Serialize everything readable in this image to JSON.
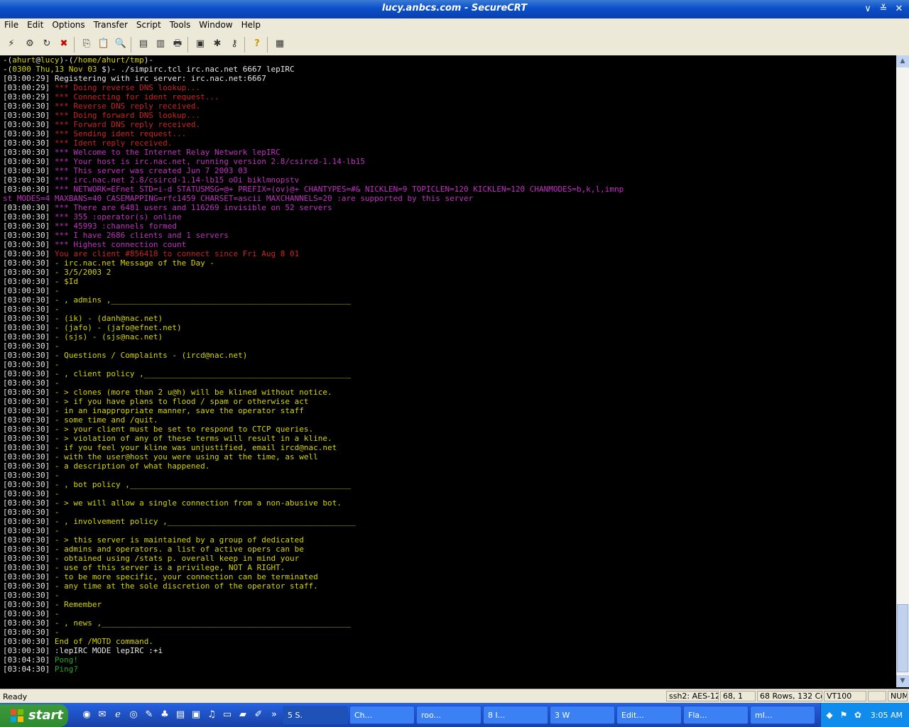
{
  "window": {
    "title": "lucy.anbcs.com - SecureCRT"
  },
  "menu": [
    "File",
    "Edit",
    "Options",
    "Transfer",
    "Script",
    "Tools",
    "Window",
    "Help"
  ],
  "prompt": {
    "line1": [
      "-(",
      "ahurt",
      "@",
      "lucy",
      ")-(",
      "/home/ahurt/tmp",
      ")-"
    ],
    "line2": [
      "-(",
      "0300 Thu,13 Nov 03 ",
      "$",
      ")-",
      " ./simpirc.tcl irc.nac.net 6667 lepIRC"
    ]
  },
  "log": [
    {
      "ts": "[03:00:29]",
      "text": "Registering with irc server: irc.nac.net:6667",
      "c": "wht"
    },
    {
      "ts": "[03:00:29]",
      "text": "*** Doing reverse DNS lookup...",
      "c": "red"
    },
    {
      "ts": "[03:00:29]",
      "text": "*** Connecting for ident request...",
      "c": "red"
    },
    {
      "ts": "[03:00:30]",
      "text": "*** Reverse DNS reply received.",
      "c": "red"
    },
    {
      "ts": "[03:00:30]",
      "text": "*** Doing forward DNS lookup...",
      "c": "red"
    },
    {
      "ts": "[03:00:30]",
      "text": "*** Forward DNS reply received.",
      "c": "red"
    },
    {
      "ts": "[03:00:30]",
      "text": "*** Sending ident request...",
      "c": "red"
    },
    {
      "ts": "[03:00:30]",
      "text": "*** Ident reply received.",
      "c": "red"
    },
    {
      "ts": "[03:00:30]",
      "text": "*** Welcome to the Internet Relay Network lepIRC",
      "c": "mag"
    },
    {
      "ts": "[03:00:30]",
      "text": "*** Your host is irc.nac.net, running version 2.8/csircd-1.14-lb15",
      "c": "mag"
    },
    {
      "ts": "[03:00:30]",
      "text": "*** This server was created Jun 7 2003 03",
      "c": "mag"
    },
    {
      "ts": "[03:00:30]",
      "text": "*** irc.nac.net 2.8/csircd-1.14-lb15 oOi biklmnopstv",
      "c": "mag"
    },
    {
      "ts": "[03:00:30]",
      "text": "*** NETWORK=EFnet STD=i-d STATUSMSG=@+ PREFIX=(ov)@+ CHANTYPES=#& NICKLEN=9 TOPICLEN=120 KICKLEN=120 CHANMODES=b,k,l,imnp",
      "c": "mag"
    },
    {
      "ts": "",
      "text": "st MODES=4 MAXBANS=40 CASEMAPPING=rfc1459 CHARSET=ascii MAXCHANNELS=20 :are supported by this server",
      "c": "mag"
    },
    {
      "ts": "[03:00:30]",
      "text": "*** There are 6481 users and 116269 invisible on 52 servers",
      "c": "mag"
    },
    {
      "ts": "[03:00:30]",
      "text": "*** 355 :operator(s) online",
      "c": "mag"
    },
    {
      "ts": "[03:00:30]",
      "text": "*** 45993 :channels formed",
      "c": "mag"
    },
    {
      "ts": "[03:00:30]",
      "text": "*** I have 2686 clients and 1 servers",
      "c": "mag"
    },
    {
      "ts": "[03:00:30]",
      "text": "*** Highest connection count",
      "c": "mag"
    },
    {
      "ts": "[03:00:30]",
      "text": "You are client #856418 to connect since Fri Aug 8 01",
      "c": "red"
    },
    {
      "ts": "[03:00:30]",
      "text": "- irc.nac.net Message of the Day -",
      "c": "yel"
    },
    {
      "ts": "[03:00:30]",
      "text": "- 3/5/2003 2",
      "c": "yel"
    },
    {
      "ts": "[03:00:30]",
      "text": "- $Id",
      "c": "yel"
    },
    {
      "ts": "[03:00:30]",
      "text": "-",
      "c": "yel"
    },
    {
      "ts": "[03:00:30]",
      "text": "- , admins ,___________________________________________________",
      "c": "yel"
    },
    {
      "ts": "[03:00:30]",
      "text": "-",
      "c": "yel"
    },
    {
      "ts": "[03:00:30]",
      "text": "- (ik) - (danh@nac.net)",
      "c": "yel"
    },
    {
      "ts": "[03:00:30]",
      "text": "- (jafo) - (jafo@efnet.net)",
      "c": "yel"
    },
    {
      "ts": "[03:00:30]",
      "text": "- (sjs) - (sjs@nac.net)",
      "c": "yel"
    },
    {
      "ts": "[03:00:30]",
      "text": "-",
      "c": "yel"
    },
    {
      "ts": "[03:00:30]",
      "text": "- Questions / Complaints - (ircd@nac.net)",
      "c": "yel"
    },
    {
      "ts": "[03:00:30]",
      "text": "-",
      "c": "yel"
    },
    {
      "ts": "[03:00:30]",
      "text": "- , client policy ,____________________________________________",
      "c": "yel"
    },
    {
      "ts": "[03:00:30]",
      "text": "-",
      "c": "yel"
    },
    {
      "ts": "[03:00:30]",
      "text": "- > clones (more than 2 u@h) will be klined without notice.",
      "c": "yel"
    },
    {
      "ts": "[03:00:30]",
      "text": "- > if you have plans to flood / spam or otherwise act",
      "c": "yel"
    },
    {
      "ts": "[03:00:30]",
      "text": "- in an inappropriate manner, save the operator staff",
      "c": "yel"
    },
    {
      "ts": "[03:00:30]",
      "text": "- some time and /quit.",
      "c": "yel"
    },
    {
      "ts": "[03:00:30]",
      "text": "- > your client must be set to respond to CTCP queries.",
      "c": "yel"
    },
    {
      "ts": "[03:00:30]",
      "text": "- > violation of any of these terms will result in a kline.",
      "c": "yel"
    },
    {
      "ts": "[03:00:30]",
      "text": "- if you feel your kline was unjustified, email ircd@nac.net",
      "c": "yel"
    },
    {
      "ts": "[03:00:30]",
      "text": "- with the user@host you were using at the time, as well",
      "c": "yel"
    },
    {
      "ts": "[03:00:30]",
      "text": "- a description of what happened.",
      "c": "yel"
    },
    {
      "ts": "[03:00:30]",
      "text": "-",
      "c": "yel"
    },
    {
      "ts": "[03:00:30]",
      "text": "- , bot policy ,_______________________________________________",
      "c": "yel"
    },
    {
      "ts": "[03:00:30]",
      "text": "-",
      "c": "yel"
    },
    {
      "ts": "[03:00:30]",
      "text": "- > we will allow a single connection from a non-abusive bot.",
      "c": "yel"
    },
    {
      "ts": "[03:00:30]",
      "text": "-",
      "c": "yel"
    },
    {
      "ts": "[03:00:30]",
      "text": "- , involvement policy ,________________________________________",
      "c": "yel"
    },
    {
      "ts": "[03:00:30]",
      "text": "-",
      "c": "yel"
    },
    {
      "ts": "[03:00:30]",
      "text": "- > this server is maintained by a group of dedicated",
      "c": "yel"
    },
    {
      "ts": "[03:00:30]",
      "text": "- admins and operators. a list of active opers can be",
      "c": "yel"
    },
    {
      "ts": "[03:00:30]",
      "text": "- obtained using /stats p. overall keep in mind your",
      "c": "yel"
    },
    {
      "ts": "[03:00:30]",
      "text": "- use of this server is a privilege, NOT A RIGHT.",
      "c": "yel"
    },
    {
      "ts": "[03:00:30]",
      "text": "- to be more specific, your connection can be terminated",
      "c": "yel"
    },
    {
      "ts": "[03:00:30]",
      "text": "- any time at the sole discretion of the operator staff.",
      "c": "yel"
    },
    {
      "ts": "[03:00:30]",
      "text": "-",
      "c": "yel"
    },
    {
      "ts": "[03:00:30]",
      "text": "- Remember",
      "c": "yel"
    },
    {
      "ts": "[03:00:30]",
      "text": "-",
      "c": "yel"
    },
    {
      "ts": "[03:00:30]",
      "text": "- , news ,_____________________________________________________",
      "c": "yel"
    },
    {
      "ts": "[03:00:30]",
      "text": "-",
      "c": "yel"
    },
    {
      "ts": "[03:00:30]",
      "text": "End of /MOTD command.",
      "c": "yel"
    },
    {
      "ts": "[03:00:30]",
      "text": ":lepIRC MODE lepIRC :+i",
      "c": "wht"
    },
    {
      "ts": "[03:04:30]",
      "text": "Pong!",
      "c": "grn"
    },
    {
      "ts": "[03:04:30]",
      "text": "Ping?",
      "c": "grn"
    }
  ],
  "status": {
    "ready": "Ready",
    "cipher": "ssh2: AES-128",
    "position": "68,  1",
    "size": "68 Rows, 132 Cols",
    "term": "VT100",
    "num": "NUM"
  },
  "taskbar": {
    "start": "start",
    "tasks": [
      "5 S.",
      "Ch...",
      "roo...",
      "8 I...",
      "3 W",
      "Edit...",
      "Fla...",
      "mI..."
    ],
    "clock": "3:05 AM"
  },
  "colors": {
    "red": "#cc2222",
    "magenta": "#c030c0",
    "yellow": "#d4d400",
    "green": "#22aa22",
    "white": "#e8e8e8"
  }
}
